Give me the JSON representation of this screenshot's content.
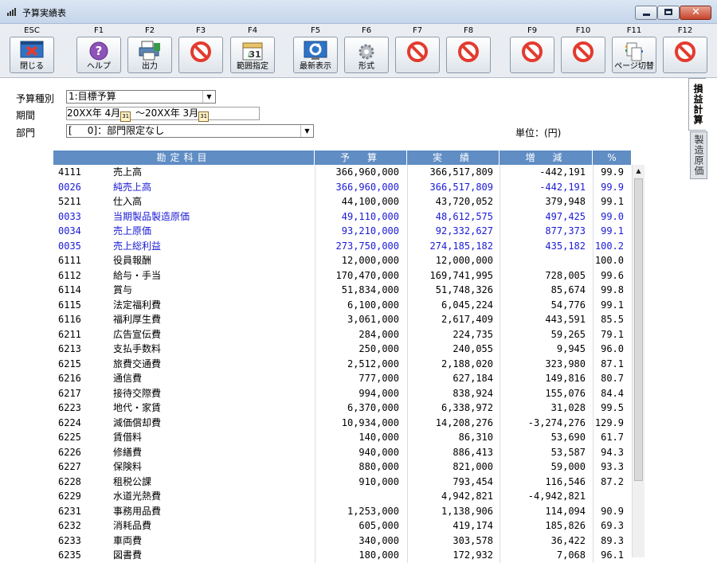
{
  "window": {
    "title": "予算実績表"
  },
  "toolbar": {
    "keys": [
      {
        "key": "ESC",
        "caption": "閉じる",
        "icon": "close-window-icon"
      },
      {
        "key": "F1",
        "caption": "ヘルプ",
        "icon": "help-icon"
      },
      {
        "key": "F2",
        "caption": "出力",
        "icon": "printer-icon"
      },
      {
        "key": "F3",
        "caption": "",
        "icon": "disabled-icon"
      },
      {
        "key": "F4",
        "caption": "範囲指定",
        "icon": "calendar-icon"
      },
      {
        "key": "F5",
        "caption": "最新表示",
        "icon": "refresh-icon"
      },
      {
        "key": "F6",
        "caption": "形式",
        "icon": "gear-icon"
      },
      {
        "key": "F7",
        "caption": "",
        "icon": "disabled-icon"
      },
      {
        "key": "F8",
        "caption": "",
        "icon": "disabled-icon"
      },
      {
        "key": "F9",
        "caption": "",
        "icon": "disabled-icon"
      },
      {
        "key": "F10",
        "caption": "",
        "icon": "disabled-icon"
      },
      {
        "key": "F11",
        "caption": "ページ切替",
        "icon": "page-switch-icon"
      },
      {
        "key": "F12",
        "caption": "",
        "icon": "disabled-icon"
      }
    ]
  },
  "filters": {
    "budget_type_label": "予算種別",
    "budget_type_value": "1:目標予算",
    "period_label": "期間",
    "period_from": "20XX年 4月",
    "period_sep": "～",
    "period_to": "20XX年 3月",
    "dept_label": "部門",
    "dept_value": "[     0]：部門限定なし",
    "unit": "単位：(円)"
  },
  "table": {
    "headers": [
      "勘定科目",
      "予　算",
      "実　績",
      "増　減",
      "%"
    ],
    "rows": [
      {
        "code": "4111",
        "name": "売上高",
        "budget": "366,960,000",
        "actual": "366,517,809",
        "diff": "-442,191",
        "pct": "99.9",
        "blue": false
      },
      {
        "code": "0026",
        "name": "純売上高",
        "budget": "366,960,000",
        "actual": "366,517,809",
        "diff": "-442,191",
        "pct": "99.9",
        "blue": true
      },
      {
        "code": "5211",
        "name": "仕入高",
        "budget": "44,100,000",
        "actual": "43,720,052",
        "diff": "379,948",
        "pct": "99.1",
        "blue": false
      },
      {
        "code": "0033",
        "name": "当期製品製造原価",
        "budget": "49,110,000",
        "actual": "48,612,575",
        "diff": "497,425",
        "pct": "99.0",
        "blue": true
      },
      {
        "code": "0034",
        "name": "売上原価",
        "budget": "93,210,000",
        "actual": "92,332,627",
        "diff": "877,373",
        "pct": "99.1",
        "blue": true
      },
      {
        "code": "0035",
        "name": "売上総利益",
        "budget": "273,750,000",
        "actual": "274,185,182",
        "diff": "435,182",
        "pct": "100.2",
        "blue": true
      },
      {
        "code": "6111",
        "name": "役員報酬",
        "budget": "12,000,000",
        "actual": "12,000,000",
        "diff": "",
        "pct": "100.0",
        "blue": false
      },
      {
        "code": "6112",
        "name": "給与・手当",
        "budget": "170,470,000",
        "actual": "169,741,995",
        "diff": "728,005",
        "pct": "99.6",
        "blue": false
      },
      {
        "code": "6114",
        "name": "賞与",
        "budget": "51,834,000",
        "actual": "51,748,326",
        "diff": "85,674",
        "pct": "99.8",
        "blue": false
      },
      {
        "code": "6115",
        "name": "法定福利費",
        "budget": "6,100,000",
        "actual": "6,045,224",
        "diff": "54,776",
        "pct": "99.1",
        "blue": false
      },
      {
        "code": "6116",
        "name": "福利厚生費",
        "budget": "3,061,000",
        "actual": "2,617,409",
        "diff": "443,591",
        "pct": "85.5",
        "blue": false
      },
      {
        "code": "6211",
        "name": "広告宣伝費",
        "budget": "284,000",
        "actual": "224,735",
        "diff": "59,265",
        "pct": "79.1",
        "blue": false
      },
      {
        "code": "6213",
        "name": "支払手数料",
        "budget": "250,000",
        "actual": "240,055",
        "diff": "9,945",
        "pct": "96.0",
        "blue": false
      },
      {
        "code": "6215",
        "name": "旅費交通費",
        "budget": "2,512,000",
        "actual": "2,188,020",
        "diff": "323,980",
        "pct": "87.1",
        "blue": false
      },
      {
        "code": "6216",
        "name": "通信費",
        "budget": "777,000",
        "actual": "627,184",
        "diff": "149,816",
        "pct": "80.7",
        "blue": false
      },
      {
        "code": "6217",
        "name": "接待交際費",
        "budget": "994,000",
        "actual": "838,924",
        "diff": "155,076",
        "pct": "84.4",
        "blue": false
      },
      {
        "code": "6223",
        "name": "地代・家賃",
        "budget": "6,370,000",
        "actual": "6,338,972",
        "diff": "31,028",
        "pct": "99.5",
        "blue": false
      },
      {
        "code": "6224",
        "name": "減価償却費",
        "budget": "10,934,000",
        "actual": "14,208,276",
        "diff": "-3,274,276",
        "pct": "129.9",
        "blue": false
      },
      {
        "code": "6225",
        "name": "賃借料",
        "budget": "140,000",
        "actual": "86,310",
        "diff": "53,690",
        "pct": "61.7",
        "blue": false
      },
      {
        "code": "6226",
        "name": "修繕費",
        "budget": "940,000",
        "actual": "886,413",
        "diff": "53,587",
        "pct": "94.3",
        "blue": false
      },
      {
        "code": "6227",
        "name": "保険料",
        "budget": "880,000",
        "actual": "821,000",
        "diff": "59,000",
        "pct": "93.3",
        "blue": false
      },
      {
        "code": "6228",
        "name": "租税公課",
        "budget": "910,000",
        "actual": "793,454",
        "diff": "116,546",
        "pct": "87.2",
        "blue": false
      },
      {
        "code": "6229",
        "name": "水道光熱費",
        "budget": "",
        "actual": "4,942,821",
        "diff": "-4,942,821",
        "pct": "",
        "blue": false
      },
      {
        "code": "6231",
        "name": "事務用品費",
        "budget": "1,253,000",
        "actual": "1,138,906",
        "diff": "114,094",
        "pct": "90.9",
        "blue": false
      },
      {
        "code": "6232",
        "name": "消耗品費",
        "budget": "605,000",
        "actual": "419,174",
        "diff": "185,826",
        "pct": "69.3",
        "blue": false
      },
      {
        "code": "6233",
        "name": "車両費",
        "budget": "340,000",
        "actual": "303,578",
        "diff": "36,422",
        "pct": "89.3",
        "blue": false
      },
      {
        "code": "6235",
        "name": "図書費",
        "budget": "180,000",
        "actual": "172,932",
        "diff": "7,068",
        "pct": "96.1",
        "blue": false
      }
    ]
  },
  "side_tabs": [
    {
      "label": "損益計算",
      "active": true
    },
    {
      "label": "製造原価",
      "active": false
    }
  ],
  "colors": {
    "header_bg": "#5f8dc4",
    "blue_text": "#1a1ad6",
    "disabled_red": "#e33b2f"
  }
}
